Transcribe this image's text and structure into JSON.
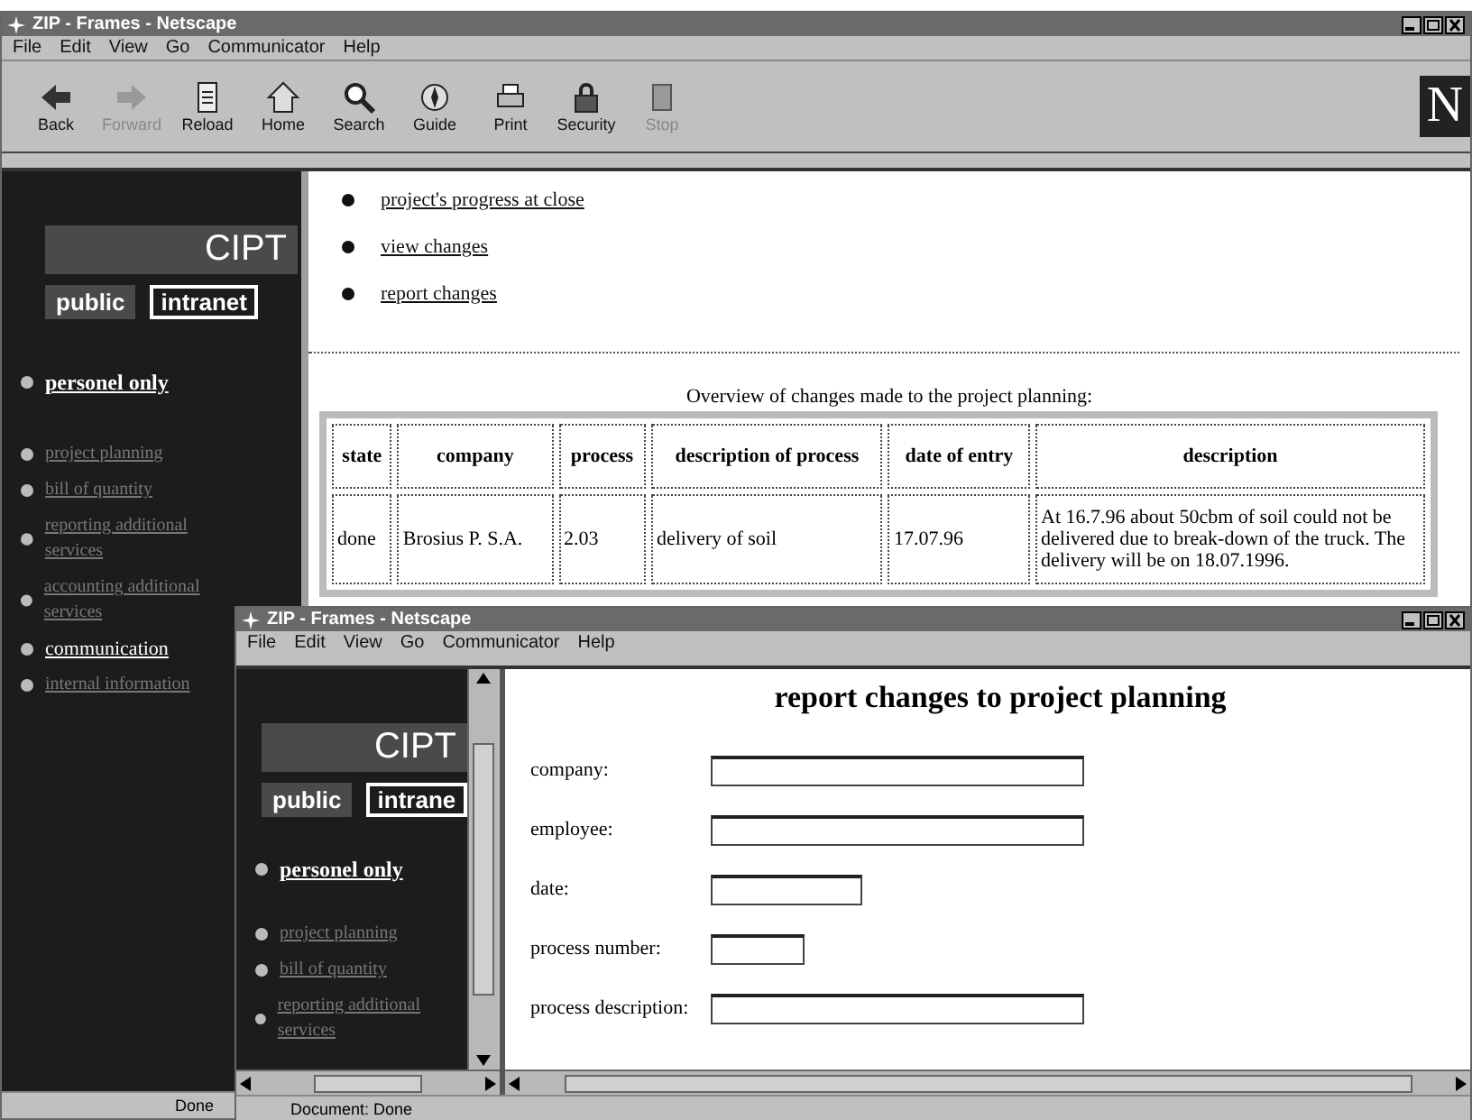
{
  "back_window": {
    "title": "ZIP - Frames - Netscape",
    "menu": [
      "File",
      "Edit",
      "View",
      "Go",
      "Communicator",
      "Help"
    ],
    "toolbar": [
      {
        "label": "Back",
        "disabled": false
      },
      {
        "label": "Forward",
        "disabled": true
      },
      {
        "label": "Reload",
        "disabled": false
      },
      {
        "label": "Home",
        "disabled": false
      },
      {
        "label": "Search",
        "disabled": false
      },
      {
        "label": "Guide",
        "disabled": false
      },
      {
        "label": "Print",
        "disabled": false
      },
      {
        "label": "Security",
        "disabled": false
      },
      {
        "label": "Stop",
        "disabled": true
      }
    ],
    "brand_mark": "N",
    "sidebar": {
      "logo": "CIPT",
      "tabs": [
        {
          "label": "public",
          "selected": false
        },
        {
          "label": "intranet",
          "selected": true
        }
      ],
      "items": [
        {
          "label": "personel only",
          "kind": "heading",
          "disabled": false
        },
        {
          "label": "project planning",
          "kind": "link",
          "disabled": true
        },
        {
          "label": "bill of quantity",
          "kind": "link",
          "disabled": true
        },
        {
          "label": "reporting additional services",
          "kind": "link",
          "disabled": true
        },
        {
          "label": "accounting additional services",
          "kind": "link",
          "disabled": true
        },
        {
          "label": "communication",
          "kind": "link",
          "disabled": false
        },
        {
          "label": "internal information",
          "kind": "link",
          "disabled": true
        }
      ]
    },
    "links": [
      "project's progress at close",
      "view changes",
      "report changes"
    ],
    "table_caption": "Overview of changes made to the project planning:",
    "table": {
      "columns": [
        "state",
        "company",
        "process",
        "description of process",
        "date of entry",
        "description"
      ],
      "rows": [
        [
          "done",
          "Brosius P. S.A.",
          "2.03",
          "delivery of soil",
          "17.07.96",
          "At 16.7.96 about 50cbm of soil could not be delivered due to break-down of the truck. The delivery will be on 18.07.1996."
        ]
      ]
    },
    "status_bar": "Done"
  },
  "front_window": {
    "title": "ZIP - Frames - Netscape",
    "menu": [
      "File",
      "Edit",
      "View",
      "Go",
      "Communicator",
      "Help"
    ],
    "sidebar": {
      "logo": "CIPT",
      "tabs": [
        {
          "label": "public",
          "selected": false
        },
        {
          "label": "intrane",
          "selected": true
        }
      ],
      "items": [
        {
          "label": "personel only",
          "kind": "heading",
          "disabled": false
        },
        {
          "label": "project planning",
          "kind": "link",
          "disabled": true
        },
        {
          "label": "bill of quantity",
          "kind": "link",
          "disabled": true
        },
        {
          "label": "reporting additional services",
          "kind": "link",
          "disabled": true
        }
      ]
    },
    "form_title": "report changes to project planning",
    "fields": [
      {
        "label": "company:",
        "kind": "long"
      },
      {
        "label": "employee:",
        "kind": "long"
      },
      {
        "label": "date:",
        "kind": "medium"
      },
      {
        "label": "process number:",
        "kind": "short"
      },
      {
        "label": "process description:",
        "kind": "long"
      }
    ],
    "status_bar": "Document: Done"
  }
}
